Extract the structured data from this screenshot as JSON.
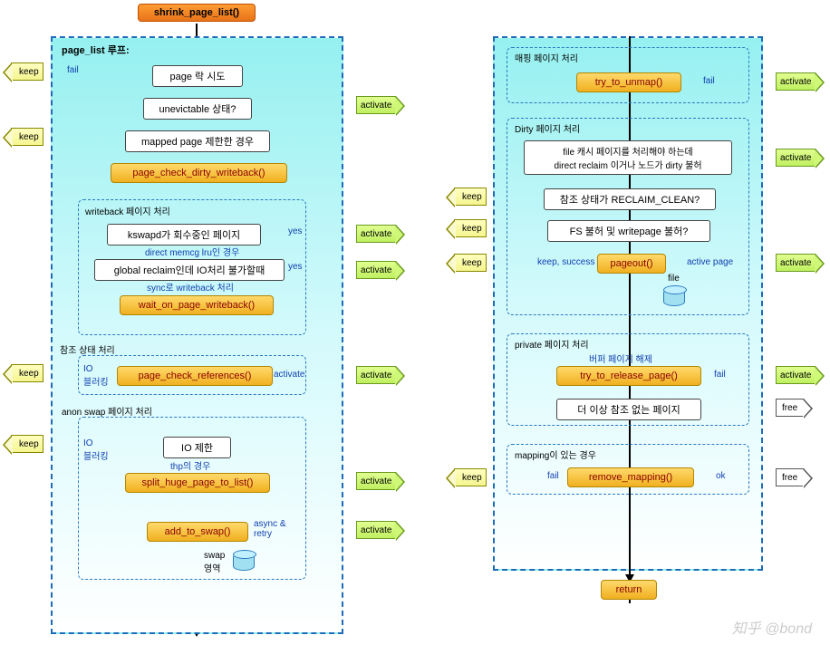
{
  "title": "shrink_page_list()",
  "left_panel": {
    "label": "page_list 루프:",
    "fail_label": "fail",
    "nodes": {
      "n1": "page 락 시도",
      "n2": "unevictable 상태?",
      "n3": "mapped page 제한한 경우",
      "n4": "page_check_dirty_writeback()"
    },
    "writeback": {
      "label": "writeback 페이지 처리",
      "n5": "kswapd가 회수중인 페이지",
      "sub1": "direct memcg lru인 경우",
      "n6": "global reclaim인데 IO처리 불가할때",
      "sub2": "sync로 writeback 처리",
      "n7": "wait_on_page_writeback()",
      "yes1": "yes",
      "yes2": "yes"
    },
    "refs": {
      "label": "참조 상태 처리",
      "io": "IO\n블러킹",
      "n8": "page_check_references()",
      "act": "activate"
    },
    "anon": {
      "label": "anon swap 페이지 처리",
      "io": "IO\n블러킹",
      "n9": "IO 제한",
      "sub": "thp의 경우",
      "n10": "split_huge_page_to_list()",
      "n11": "add_to_swap()",
      "async": "async &\nretry",
      "swap": "swap\n영역"
    }
  },
  "right_panel": {
    "mapping": {
      "label": "매핑 페이지 처리",
      "n1": "try_to_unmap()",
      "fail": "fail"
    },
    "dirty": {
      "label": "Dirty 페이지 처리",
      "n2": "file 캐시 페이지를 처리해야 하는데\ndirect reclaim 이거나 노드가 dirty 불허",
      "n3": "참조 상태가 RECLAIM_CLEAN?",
      "n4": "FS 불허 및 writepage 불허?",
      "keep_success": "keep, success",
      "n5": "pageout()",
      "active": "active page",
      "file": "file"
    },
    "private": {
      "label": "private 페이지 처리",
      "sub": "버퍼 페이지 해제",
      "n6": "try_to_release_page()",
      "fail": "fail",
      "n7": "더 이상 참조 없는 페이지"
    },
    "remove": {
      "label": "mapping이 있는 경우",
      "fail": "fail",
      "n8": "remove_mapping()",
      "ok": "ok"
    },
    "ret": "return"
  },
  "arrows": {
    "keep": "keep",
    "activate": "activate",
    "free": "free"
  },
  "watermark": "知乎 @bond"
}
